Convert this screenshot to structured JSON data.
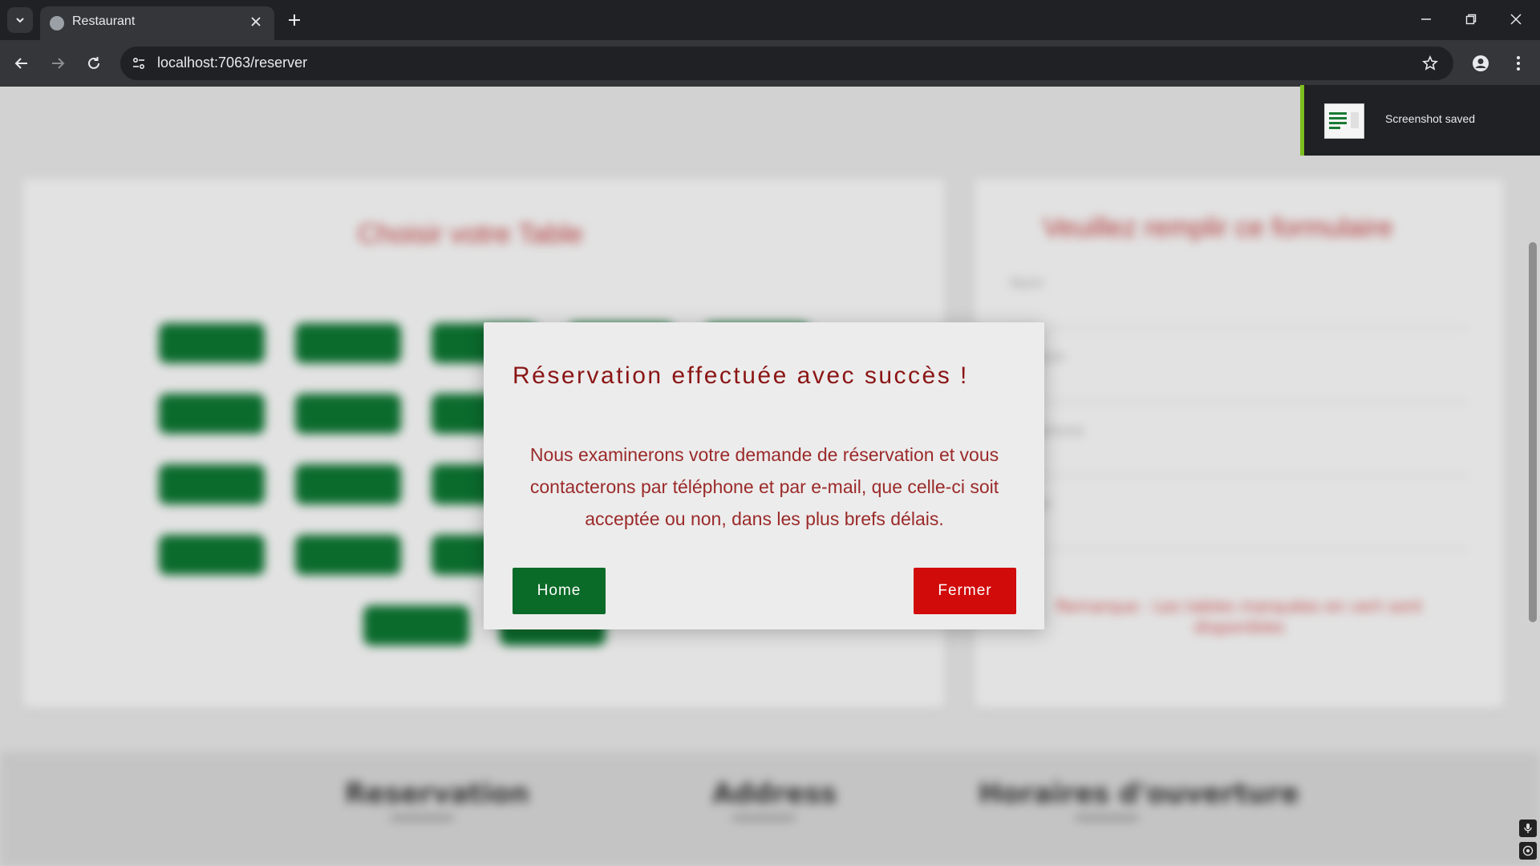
{
  "browser": {
    "tab_title": "Restaurant",
    "url": "localhost:7063/reserver",
    "icons": [
      "chevron-down-icon",
      "globe-icon",
      "close-icon",
      "plus-icon",
      "minimize-icon",
      "restore-icon",
      "close-window-icon",
      "back-icon",
      "forward-icon",
      "reload-icon",
      "site-info-icon",
      "star-icon",
      "profile-icon",
      "menu-icon"
    ]
  },
  "toast": {
    "message": "Screenshot saved",
    "accent_color": "#7cbf1e"
  },
  "background_page": {
    "left_card_title": "Choisir votre Table",
    "right_card_title": "Veuillez remplir ce formulaire",
    "form_labels": [
      "Nom",
      "Prénom",
      "Téléphone",
      "Email"
    ],
    "note": "Remarque : Les tables marquées en vert sont disponibles",
    "footer_headings": [
      "Reservation",
      "Address",
      "Horaires d'ouverture"
    ]
  },
  "modal": {
    "title": "Réservation effectuée avec succès !",
    "body": "Nous examinerons votre demande de réservation et vous contacterons par téléphone et par e-mail, que celle-ci soit acceptée ou non, dans les plus brefs délais.",
    "home_label": "Home",
    "close_label": "Fermer",
    "colors": {
      "title": "#8b1515",
      "home_button": "#0a6a28",
      "close_button": "#d10a0a"
    }
  }
}
